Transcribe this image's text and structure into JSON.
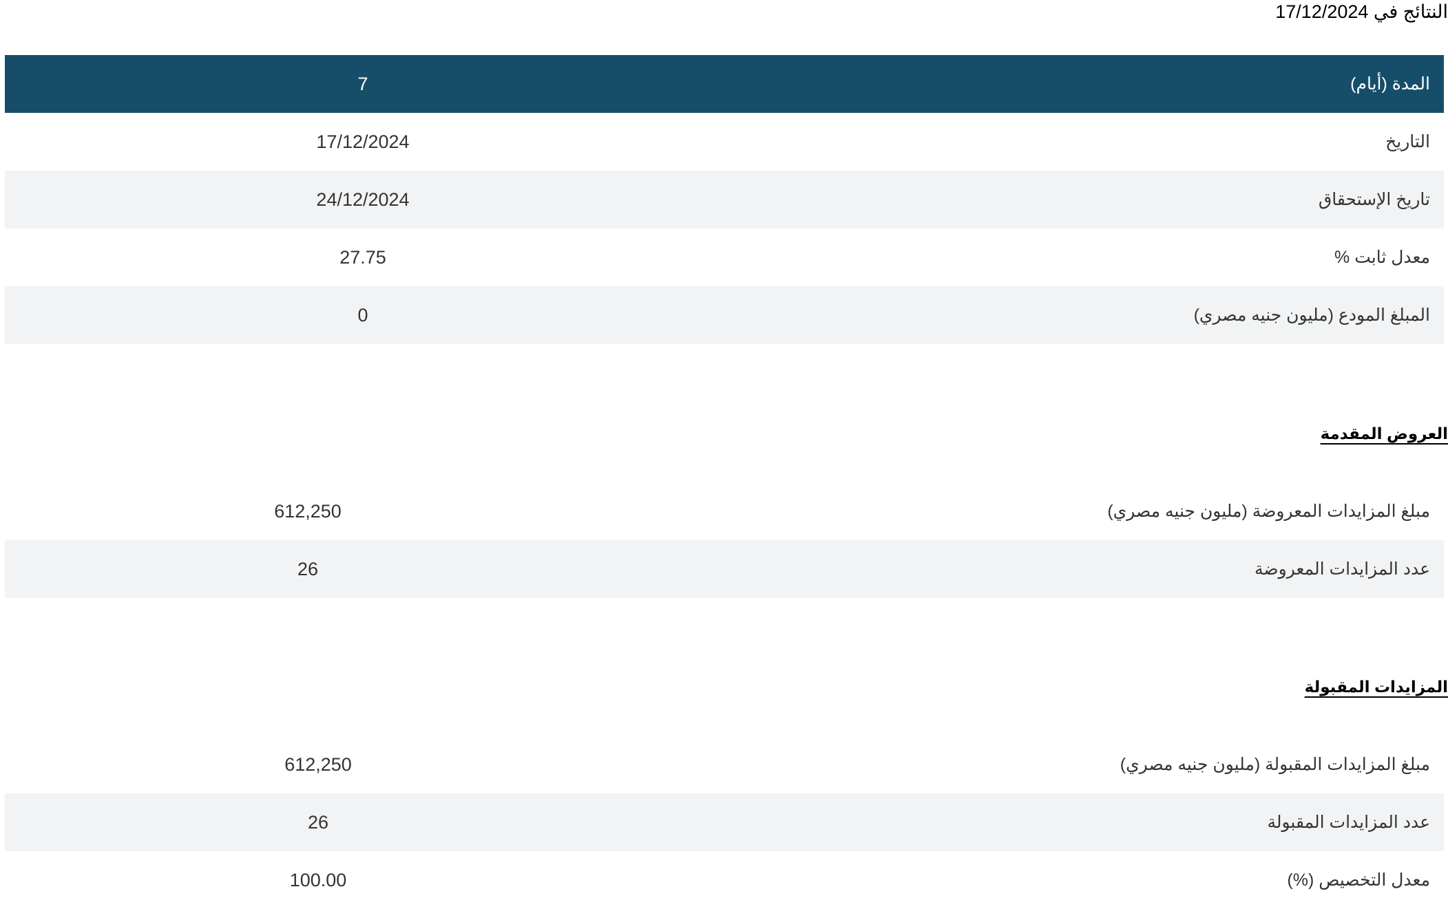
{
  "results_title": "النتائج في 17/12/2024",
  "summary_table": {
    "rows": [
      {
        "label": "المدة (أيام)",
        "value": "7"
      },
      {
        "label": "التاريخ",
        "value": "17/12/2024"
      },
      {
        "label": "تاريخ الإستحقاق",
        "value": "24/12/2024"
      },
      {
        "label": "معدل ثابت %",
        "value": "27.75"
      },
      {
        "label": "المبلغ المودع (مليون جنيه مصري)",
        "value": "0"
      }
    ]
  },
  "offered_section": {
    "heading": "العروض المقدمة",
    "rows": [
      {
        "label": "مبلغ المزايدات المعروضة (مليون جنيه مصري)",
        "value": "612,250"
      },
      {
        "label": "عدد المزايدات المعروضة",
        "value": "26"
      }
    ]
  },
  "accepted_section": {
    "heading": "المزايدات المقبولة",
    "rows": [
      {
        "label": "مبلغ المزايدات المقبولة (مليون جنيه مصري)",
        "value": "612,250"
      },
      {
        "label": "عدد المزايدات المقبولة",
        "value": "26"
      },
      {
        "label": "معدل التخصيص (%)",
        "value": "100.00"
      }
    ]
  },
  "colors": {
    "header_background": "#164e69",
    "alt_row_background": "#f2f3f4",
    "text": "#333333"
  }
}
